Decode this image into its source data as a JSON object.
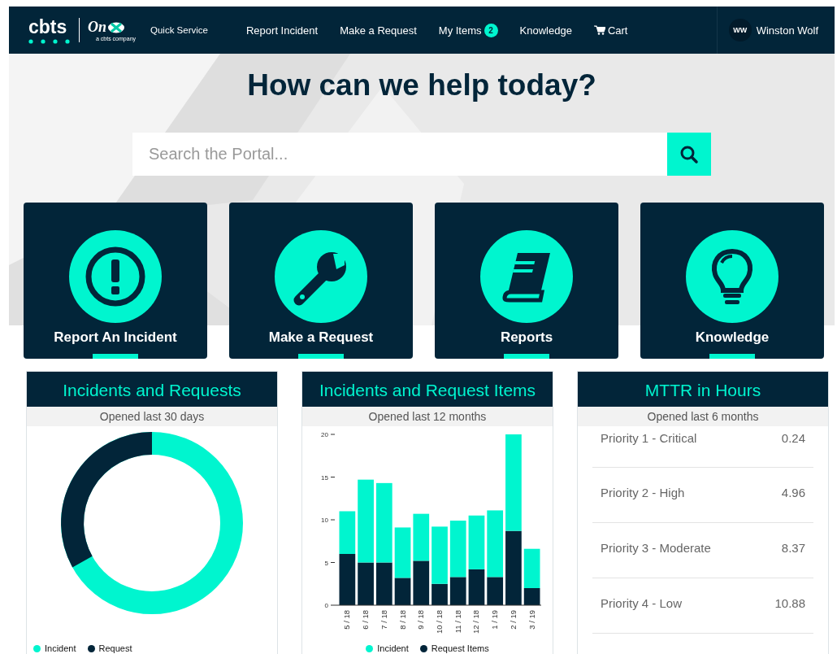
{
  "header": {
    "brand": "cbts",
    "partner_logo": "On",
    "partner_tagline": "a cbts company",
    "nav": [
      {
        "label": "Quick Service",
        "kind": "small"
      },
      {
        "label": "Report Incident",
        "kind": "link"
      },
      {
        "label": "Make a Request",
        "kind": "link"
      },
      {
        "label": "My Items",
        "kind": "link",
        "badge": "2"
      },
      {
        "label": "Knowledge",
        "kind": "link"
      },
      {
        "label": "Cart",
        "kind": "cart"
      }
    ],
    "user": {
      "initials": "WW",
      "name": "Winston Wolf"
    }
  },
  "hero": {
    "title": "How can we help today?",
    "search": {
      "placeholder": "Search the Portal..."
    }
  },
  "tiles": [
    {
      "label": "Report An Incident"
    },
    {
      "label": "Make a Request"
    },
    {
      "label": "Reports"
    },
    {
      "label": "Knowledge"
    }
  ],
  "cards": [
    {
      "kind": "donut",
      "title": "Incidents and Requests",
      "subtitle": "Opened last 30 days",
      "legend": [
        {
          "label": "Incident",
          "color": "#00f5cf"
        },
        {
          "label": "Request",
          "color": "#022539"
        }
      ]
    },
    {
      "kind": "bar",
      "title": "Incidents and Request Items",
      "subtitle": "Opened last 12 months",
      "chart_data": {
        "type": "bar",
        "stacked": true,
        "categories": [
          "5 / 18",
          "6 / 18",
          "7 / 18",
          "8 / 18",
          "9 / 18",
          "10 / 18",
          "11 / 18",
          "12 / 18",
          "1 / 19",
          "2 / 19",
          "3 / 19"
        ],
        "ylim": [
          0,
          20
        ],
        "yticks": [
          0,
          5,
          10,
          15,
          20
        ],
        "series": [
          {
            "name": "Request Items",
            "color": "#022539",
            "values": [
              6,
              5,
              5,
              3.2,
              5.2,
              2.5,
              3.3,
              4.2,
              3.3,
              8.7,
              2
            ]
          },
          {
            "name": "Incident",
            "color": "#00f5cf",
            "values": [
              5,
              9.7,
              9.3,
              5.9,
              5.5,
              6.7,
              6.6,
              6.3,
              7.8,
              11.3,
              4.6
            ]
          }
        ]
      }
    },
    {
      "kind": "list",
      "title": "MTTR in Hours",
      "subtitle": "Opened last 6 months",
      "rows": [
        {
          "label": "Priority 1 - Critical",
          "value": "0.24"
        },
        {
          "label": "Priority 2 - High",
          "value": "4.96"
        },
        {
          "label": "Priority 3 - Moderate",
          "value": "8.37"
        },
        {
          "label": "Priority 4 - Low",
          "value": "10.88"
        }
      ]
    }
  ]
}
